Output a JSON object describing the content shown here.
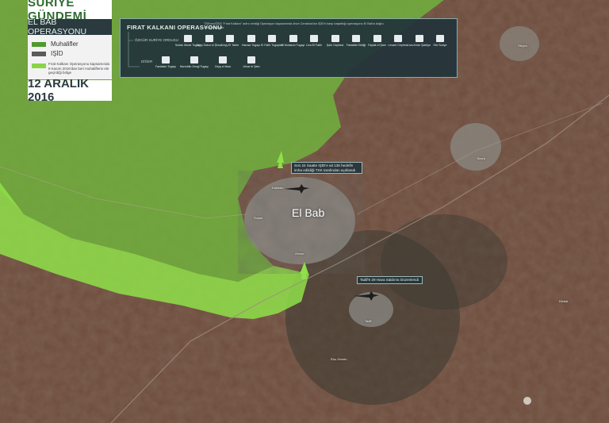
{
  "header": {
    "title": "SURİYE GÜNDEMİ",
    "subtitle": "EL BAB OPERASYONU",
    "date": "12 ARALIK 2016"
  },
  "legend": {
    "items": [
      {
        "label": "Muhalifler",
        "color": "#4f9a2a"
      },
      {
        "label": "IŞİD",
        "color": "#5a5a5a"
      }
    ],
    "note": "Fırat Kalkanı Operasyonu kapsamında 9 Kasım 2016'dan beri muhaliflerin ele geçirdiği bölge",
    "note_color": "#8bd44a"
  },
  "operation_panel": {
    "title": "FIRAT KALKANI OPERASYONU",
    "description": "TSK'nın/ÖSO \"Fırat Kalkanı\" adını verdiği Operasyon kapsamında önce Cerablus'tan IŞİD'e karşı başlattığı operasyonu El Bab'a doğru sürdürmektedir.",
    "group1_label": "ÖZGÜR SURİYE ORDUSU",
    "group2_label": "DİĞER",
    "group1": [
      "Sultan Murat Tugayı",
      "Ceyş Sukur el Şimal",
      "Ceyş El Tahrir",
      "Hamza Tugayı",
      "El Fatih Tugayları",
      "El Mutasım Tugayı",
      "Liva El Fatih",
      "Şam Cephesi",
      "Fastakim Birliği",
      "Faylak el Şam",
      "Levant Cephesi",
      "Liva Ahrar Şarkiye",
      "Hür Suriye"
    ],
    "group2": [
      "Fastakim Tugayı",
      "Nureddin Zengi Tugayı",
      "Ceyş el Nasr",
      "Ahrar el Şam"
    ]
  },
  "annotations": [
    "Son 24 Saatte IŞİD'e ait 136 hedefin imha edildiği TSK tarafından açıklandı",
    "Tadif'e 29 Hava Saldırısı Düzenlendi"
  ],
  "places": {
    "main_city": "El Bab",
    "towns": [
      "Kabasin",
      "Bza'a",
      "Tadif",
      "Ebu Zendin",
      "Suşan",
      "Zerzur",
      "Kibbat",
      "Sfeyra"
    ]
  },
  "colors": {
    "rebel_zone": "#79c245",
    "operation_zone": "#8fe04a",
    "terrain": "#6b4a3a",
    "panel": "#23343c"
  }
}
